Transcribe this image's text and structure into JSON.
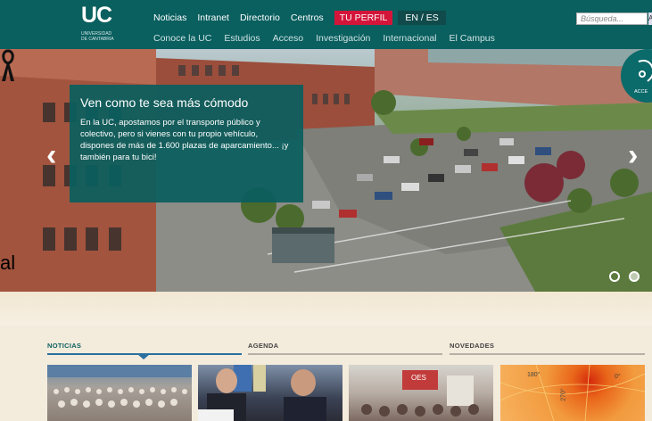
{
  "header": {
    "logo_text": "UC",
    "logo_subtitle_1": "UNIVERSIDAD",
    "logo_subtitle_2": "DE CANTABRIA",
    "top_nav": [
      "Noticias",
      "Intranet",
      "Directorio",
      "Centros"
    ],
    "profile_label": "TU PERFIL",
    "lang_label": "EN / ES",
    "sub_nav": [
      "Conoce la UC",
      "Estudios",
      "Acceso",
      "Investigación",
      "Internacional",
      "El Campus"
    ],
    "search_placeholder": "Búsqueda...",
    "search_button": "A"
  },
  "hero": {
    "title": "Ven como te sea más cómodo",
    "text": "En la UC, apostamos por el transporte público y colectivo, pero si vienes con tu propio vehículo, dispones de más de 1.600 plazas de aparcamiento... ¡y también para tu bici!",
    "prev_arrow": "‹",
    "next_arrow": "›",
    "accessibility_label": "ACCE",
    "side_fragment": "al"
  },
  "sections": {
    "news": "NOTICIAS",
    "agenda": "AGENDA",
    "novedades": "NOVEDADES"
  },
  "thumbs": {
    "t3_text": "OES",
    "t4_labels": [
      "180°",
      "0°",
      "270°"
    ]
  },
  "colors": {
    "brand_teal": "#0a5f5f",
    "profile_red": "#d4153a",
    "active_blue": "#2a6fa0"
  }
}
